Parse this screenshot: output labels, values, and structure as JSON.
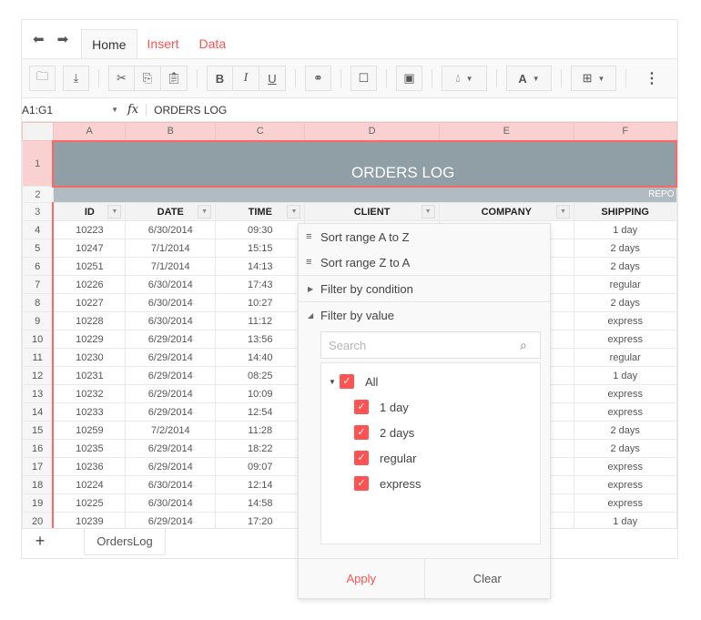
{
  "tabs": [
    {
      "label": "Home",
      "active": true
    },
    {
      "label": "Insert",
      "active": false
    },
    {
      "label": "Data",
      "active": false
    }
  ],
  "toolbar": {
    "icons": [
      "open-icon",
      "download-icon",
      "cut-icon",
      "copy-icon",
      "paste-icon",
      "bold-icon",
      "italic-icon",
      "underline-icon",
      "link-icon",
      "comment-icon",
      "image-icon",
      "fill-color-icon",
      "text-color-icon",
      "borders-icon",
      "more-icon"
    ],
    "bold": "B",
    "italic": "I",
    "underline": "U",
    "text_color": "A"
  },
  "formula_bar": {
    "cell_ref": "A1:G1",
    "fx": "fx",
    "value": "ORDERS LOG"
  },
  "columns": [
    "A",
    "B",
    "C",
    "D",
    "E",
    "F"
  ],
  "sheet": {
    "title": "ORDERS LOG",
    "subtitle": "REPO",
    "headers": [
      "ID",
      "DATE",
      "TIME",
      "CLIENT",
      "COMPANY",
      "SHIPPING"
    ],
    "rows": [
      {
        "n": "4",
        "id": "10223",
        "date": "6/30/2014",
        "time": "09:30",
        "shipping": "1 day"
      },
      {
        "n": "5",
        "id": "10247",
        "date": "7/1/2014",
        "time": "15:15",
        "shipping": "2 days"
      },
      {
        "n": "6",
        "id": "10251",
        "date": "7/1/2014",
        "time": "14:13",
        "shipping": "2 days"
      },
      {
        "n": "7",
        "id": "10226",
        "date": "6/30/2014",
        "time": "17:43",
        "shipping": "regular"
      },
      {
        "n": "8",
        "id": "10227",
        "date": "6/30/2014",
        "time": "10:27",
        "shipping": "2 days"
      },
      {
        "n": "9",
        "id": "10228",
        "date": "6/30/2014",
        "time": "11:12",
        "shipping": "express"
      },
      {
        "n": "10",
        "id": "10229",
        "date": "6/29/2014",
        "time": "13:56",
        "shipping": "express"
      },
      {
        "n": "11",
        "id": "10230",
        "date": "6/29/2014",
        "time": "14:40",
        "shipping": "regular"
      },
      {
        "n": "12",
        "id": "10231",
        "date": "6/29/2014",
        "time": "08:25",
        "shipping": "1 day"
      },
      {
        "n": "13",
        "id": "10232",
        "date": "6/29/2014",
        "time": "10:09",
        "shipping": "express"
      },
      {
        "n": "14",
        "id": "10233",
        "date": "6/29/2014",
        "time": "12:54",
        "shipping": "express"
      },
      {
        "n": "15",
        "id": "10259",
        "date": "7/2/2014",
        "time": "11:28",
        "shipping": "2 days"
      },
      {
        "n": "16",
        "id": "10235",
        "date": "6/29/2014",
        "time": "18:22",
        "shipping": "2 days"
      },
      {
        "n": "17",
        "id": "10236",
        "date": "6/29/2014",
        "time": "09:07",
        "shipping": "express"
      },
      {
        "n": "18",
        "id": "10224",
        "date": "6/30/2014",
        "time": "12:14",
        "shipping": "express"
      },
      {
        "n": "19",
        "id": "10225",
        "date": "6/30/2014",
        "time": "14:58",
        "shipping": "express"
      },
      {
        "n": "20",
        "id": "10239",
        "date": "6/29/2014",
        "time": "17:20",
        "shipping": "1 day"
      }
    ]
  },
  "sheet_tabs": {
    "add": "+",
    "tabs": [
      "OrdersLog"
    ]
  },
  "filter_menu": {
    "sort_az": "Sort range A to Z",
    "sort_za": "Sort range Z to A",
    "filter_condition": "Filter by condition",
    "filter_value": "Filter by value",
    "search_placeholder": "Search",
    "all_label": "All",
    "values": [
      {
        "label": "1 day",
        "checked": true
      },
      {
        "label": "2 days",
        "checked": true
      },
      {
        "label": "regular",
        "checked": true
      },
      {
        "label": "express",
        "checked": true
      }
    ],
    "apply": "Apply",
    "clear": "Clear"
  },
  "colors": {
    "accent": "#ff5252",
    "column_header_bg": "#f9d1d1",
    "title_bg": "#909fa6",
    "subtitle_bg": "#b0bcc2"
  }
}
